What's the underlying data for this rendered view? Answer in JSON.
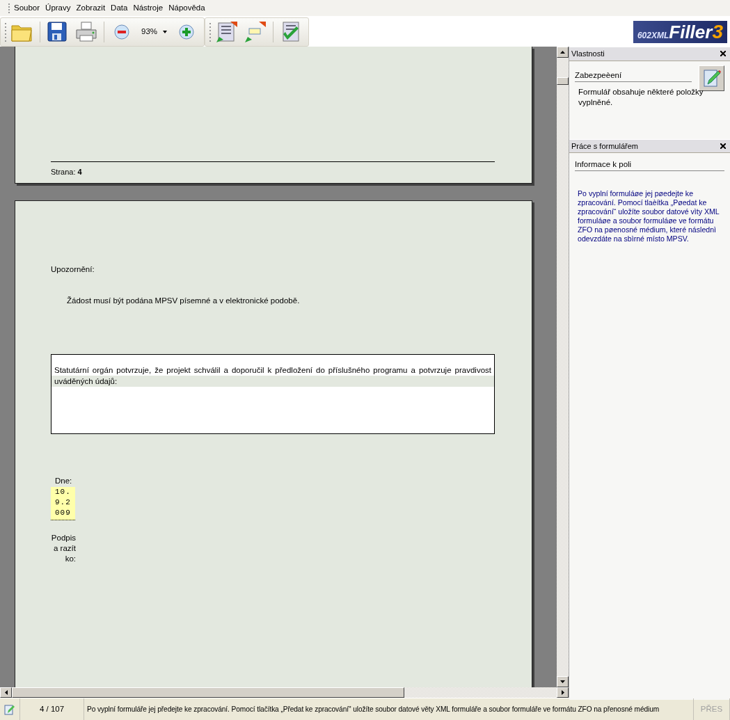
{
  "menu": [
    "Soubor",
    "Úpravy",
    "Zobrazit",
    "Data",
    "Nástroje",
    "Nápověda"
  ],
  "toolbar": {
    "zoom": "93%"
  },
  "logo": {
    "prefix": "602XML",
    "name": "Filler",
    "version": "3"
  },
  "document": {
    "footer": {
      "label": "Strana:",
      "number": "4"
    },
    "heading": "Upozornění:",
    "notice": "Žádost musí být podána MPSV písemné a v elektronické podobě.",
    "statement": "Statutární orgán potvrzuje, že projekt  schválil a doporučil k předložení do příslušného programu a potvrzuje pravdivost uváděných údajů:",
    "date_label": "Dne:",
    "date_value": "10.9.2009",
    "signature_label": "Podpis a razítko:"
  },
  "panels": [
    {
      "title": "Vlastnosti",
      "section": "Zabezpeèení",
      "text": "Formulář obsahuje některé položky vyplněné.",
      "kind": "properties"
    },
    {
      "title": "Práce s formulářem",
      "section": "Informace k poli",
      "text": "Po vyplní formuláøe jej pøedejte ke zpracování. Pomocí tlaèítka „Pøedat ke zpracování“ uložíte soubor datové vìty XML formuláøe a soubor formuláøe ve formátu ZFO na pøenosné médium, které následnì odevzdáte na sbìrné místo MPSV.",
      "kind": "help"
    }
  ],
  "status_bar": {
    "page": "4 / 107",
    "message": "Po vyplní formuláře jej předejte ke zpracování. Pomocí tlačítka „Předat ke zpracování\" uložíte soubor datové věty XML formuláře a soubor formuláře ve formátu ZFO na přenosné médium",
    "mode": "PŘES",
    "mode_disabled": true
  }
}
